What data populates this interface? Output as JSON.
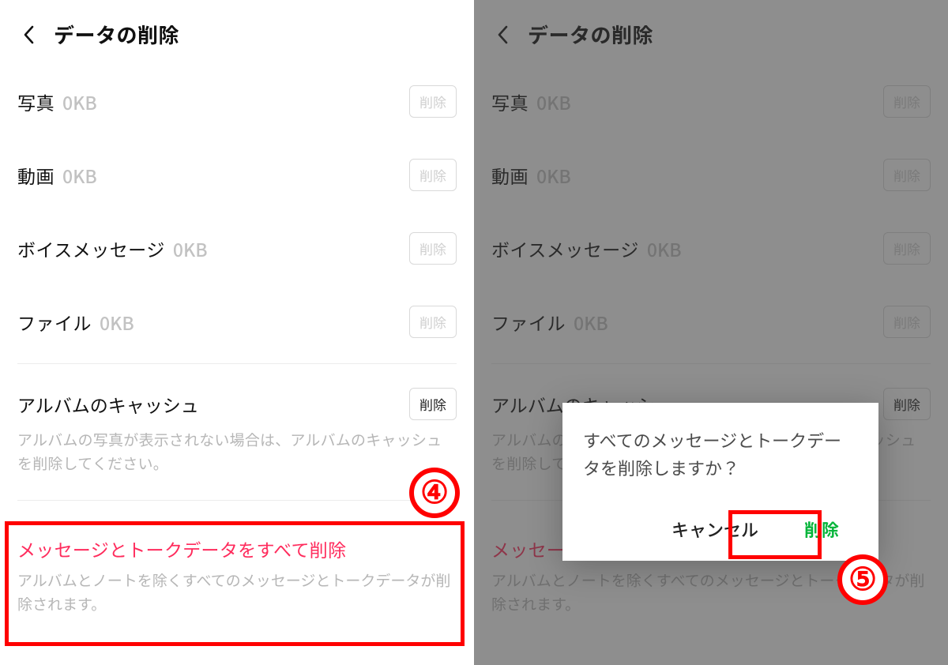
{
  "left": {
    "header_title": "データの削除",
    "rows": [
      {
        "name": "写真",
        "size": "0KB",
        "btn": "削除"
      },
      {
        "name": "動画",
        "size": "0KB",
        "btn": "削除"
      },
      {
        "name": "ボイスメッセージ",
        "size": "0KB",
        "btn": "削除"
      },
      {
        "name": "ファイル",
        "size": "0KB",
        "btn": "削除"
      }
    ],
    "album": {
      "title": "アルバムのキャッシュ",
      "btn": "削除",
      "desc": "アルバムの写真が表示されない場合は、アルバムのキャッシュを削除してください。"
    },
    "msg": {
      "title": "メッセージとトークデータをすべて削除",
      "desc": "アルバムとノートを除くすべてのメッセージとトークデータが削除されます。"
    }
  },
  "right": {
    "header_title": "データの削除",
    "rows": [
      {
        "name": "写真",
        "size": "0KB",
        "btn": "削除"
      },
      {
        "name": "動画",
        "size": "0KB",
        "btn": "削除"
      },
      {
        "name": "ボイスメッセージ",
        "size": "0KB",
        "btn": "削除"
      },
      {
        "name": "ファイル",
        "size": "0KB",
        "btn": "削除"
      }
    ],
    "album": {
      "title": "アルバムのキャッシュ",
      "btn": "削除",
      "desc": "アルバムの写真が表示されない場合は、アルバムのキャッシュを削除してください。"
    },
    "msg": {
      "title": "メッセージとトークデータをすべて削除",
      "desc": "アルバムとノートを除くすべてのメッセージとトークデータが削除されます。"
    },
    "dialog": {
      "message": "すべてのメッセージとトークデータを削除しますか？",
      "cancel": "キャンセル",
      "confirm": "削除"
    }
  },
  "callouts": {
    "badge4": "④",
    "badge5": "⑤"
  },
  "colors": {
    "accent_red": "#ff0000",
    "danger_text": "#ff2b5c",
    "confirm_green": "#07b53b"
  }
}
